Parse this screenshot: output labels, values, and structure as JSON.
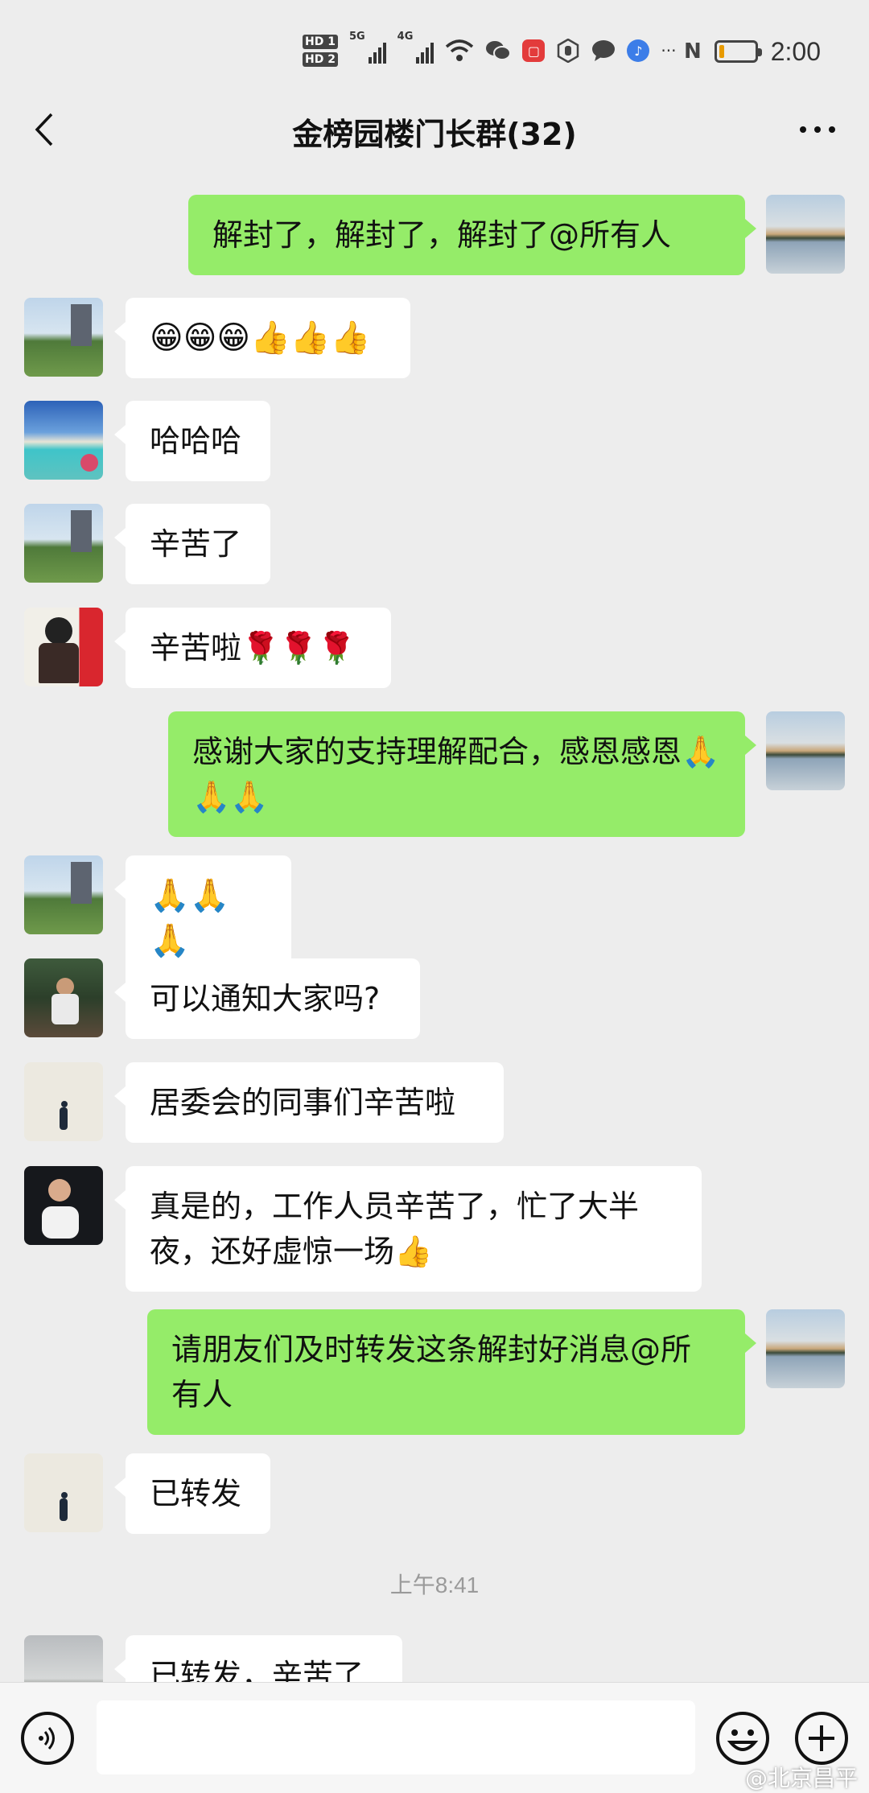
{
  "status_bar": {
    "hd1": "HD 1",
    "hd2": "HD 2",
    "net1": "5G",
    "net2": "4G",
    "ellipsis": "···",
    "nfc": "N",
    "time": "2:00",
    "battery_level": 0.15
  },
  "header": {
    "back_icon": "chevron-left-icon",
    "title": "金榜园楼门长群(32)",
    "more_icon": "more-dots-icon"
  },
  "messages": [
    {
      "side": "out",
      "text": "解封了，解封了，解封了@所有人"
    },
    {
      "side": "in",
      "text": "😁😁😁👍👍👍"
    },
    {
      "side": "in",
      "text": "哈哈哈"
    },
    {
      "side": "in",
      "text": "辛苦了"
    },
    {
      "side": "in",
      "text": "辛苦啦🌹🌹🌹"
    },
    {
      "side": "out",
      "text": "感谢大家的支持理解配合，感恩感恩🙏🙏🙏"
    },
    {
      "side": "in",
      "text": "🙏🙏🙏"
    },
    {
      "side": "in",
      "text": "可以通知大家吗?"
    },
    {
      "side": "in",
      "text": "居委会的同事们辛苦啦"
    },
    {
      "side": "in",
      "text": "真是的，工作人员辛苦了，忙了大半夜，还好虚惊一场👍"
    },
    {
      "side": "out",
      "text": "请朋友们及时转发这条解封好消息@所有人"
    },
    {
      "side": "in",
      "text": "已转发"
    },
    {
      "side": "in",
      "text": "已转发，辛苦了"
    }
  ],
  "timestamp": "上午8:41",
  "input_bar": {
    "voice_icon": "voice-icon",
    "input_value": "",
    "emoji_icon": "emoji-smile-icon",
    "plus_icon": "plus-circle-icon"
  },
  "watermark": "@北京昌平"
}
